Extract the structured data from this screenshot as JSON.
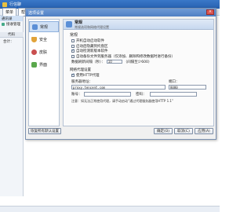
{
  "app": {
    "title": "行信聊",
    "menu": [
      "菜单",
      "帮助"
    ],
    "left_items": [
      "通讯录",
      "接收管理"
    ],
    "grid_header": "代码",
    "total_label": "合计："
  },
  "dialog": {
    "title": "选项设置",
    "close": "×",
    "nav": [
      {
        "label": "常规",
        "icon": "general-icon"
      },
      {
        "label": "安全",
        "icon": "security-icon"
      },
      {
        "label": "皮肤",
        "icon": "skin-icon"
      },
      {
        "label": "界面",
        "icon": "interface-icon"
      }
    ],
    "header": {
      "title": "常规",
      "subtitle": "常规选项和网络代理设置"
    },
    "general_title": "常规",
    "options": [
      {
        "label": "开机自动启动软件",
        "checked": false
      },
      {
        "label": "启动后隐藏到托盘区",
        "checked": false
      },
      {
        "label": "自动检测新版本软件",
        "checked": true
      },
      {
        "label": "自动备份文件到服务器（仅添加、删除和修改数据时进行备份）",
        "checked": false
      }
    ],
    "interval_label": "数据刷新间隔（秒）：",
    "interval_value": "10",
    "interval_hint": "（间隔至少600）",
    "proxy_title": "网络代理设置",
    "use_proxy_label": "使用HTTP代理",
    "use_proxy_checked": true,
    "server_label": "服务器地址：",
    "server_value": "proxy.tencent.com",
    "port_label": "端口：",
    "port_value": "8080",
    "account_label": "账号：",
    "account_value": "",
    "password_label": "密码：",
    "password_value": "",
    "note": "注意：如无法正常使用代理，请手动启动“通过代理服务器使用HTTP 1.1”",
    "buttons": {
      "restore": "恢复所有默认设置",
      "ok": "确定(O)",
      "cancel": "取消(C)",
      "apply": "应用(A)"
    }
  }
}
